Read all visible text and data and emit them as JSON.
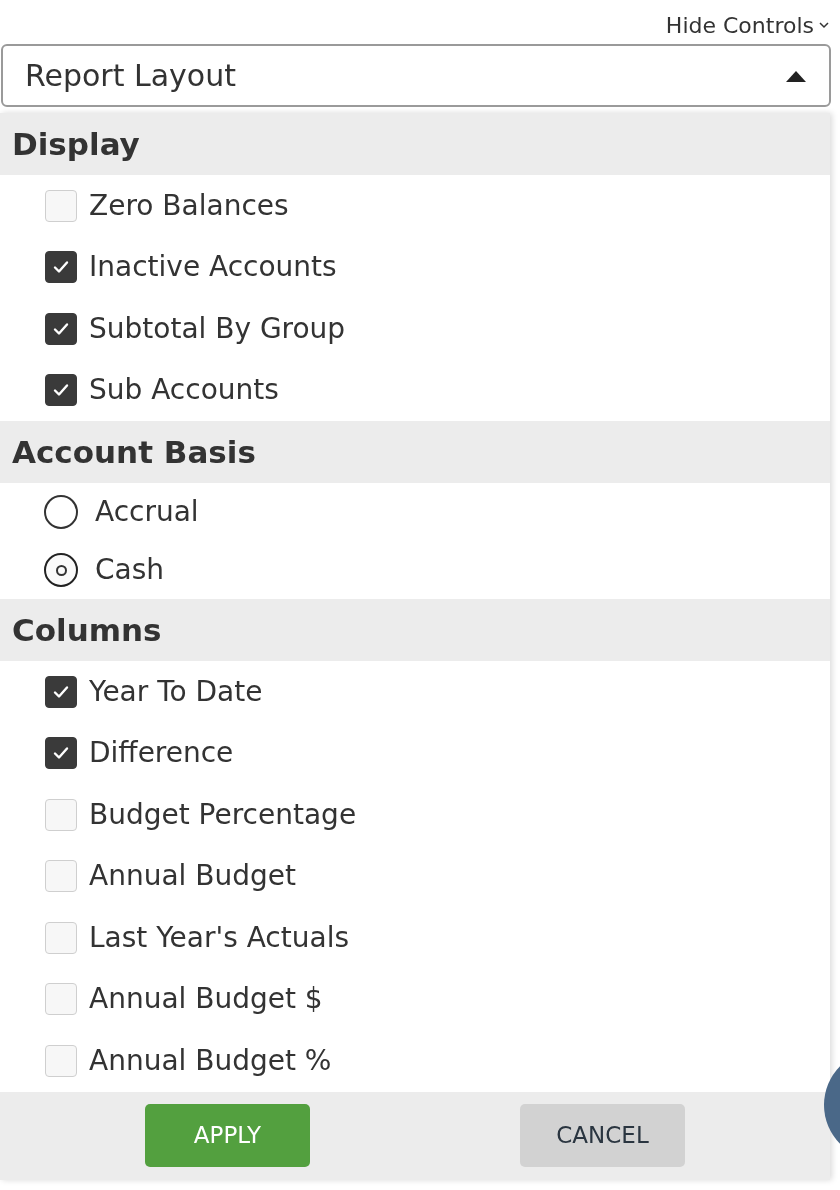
{
  "hide_controls": {
    "label": "Hide Controls"
  },
  "dropdown": {
    "label": "Report Layout",
    "expanded": true
  },
  "sections": [
    {
      "title": "Display",
      "kind": "checkbox",
      "items": [
        {
          "label": "Zero Balances",
          "checked": false
        },
        {
          "label": "Inactive Accounts",
          "checked": true
        },
        {
          "label": "Subtotal By Group",
          "checked": true
        },
        {
          "label": "Sub Accounts",
          "checked": true
        }
      ]
    },
    {
      "title": "Account Basis",
      "kind": "radio",
      "items": [
        {
          "label": "Accrual",
          "selected": false
        },
        {
          "label": "Cash",
          "selected": true
        }
      ]
    },
    {
      "title": "Columns",
      "kind": "checkbox",
      "items": [
        {
          "label": "Year To Date",
          "checked": true
        },
        {
          "label": "Difference",
          "checked": true
        },
        {
          "label": "Budget Percentage",
          "checked": false
        },
        {
          "label": "Annual Budget",
          "checked": false
        },
        {
          "label": "Last Year's Actuals",
          "checked": false
        },
        {
          "label": "Annual Budget $",
          "checked": false
        },
        {
          "label": "Annual Budget %",
          "checked": false
        }
      ]
    }
  ],
  "buttons": [
    {
      "label": "APPLY",
      "kind": "primary"
    },
    {
      "label": "CANCEL",
      "kind": "secondary"
    }
  ]
}
